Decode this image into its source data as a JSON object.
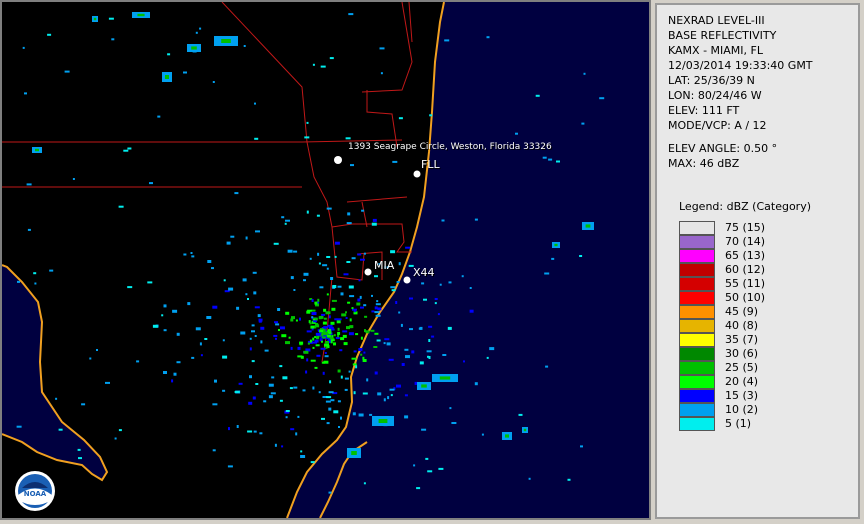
{
  "info": {
    "product_line1": "NEXRAD LEVEL-III",
    "product_line2": "BASE REFLECTIVITY",
    "station": "KAMX - MIAMI, FL",
    "datetime": "12/03/2014 19:33:40 GMT",
    "lat": "LAT: 25/36/39 N",
    "lon": "LON: 80/24/46 W",
    "elev": "ELEV: 111 FT",
    "mode": "MODE/VCP: A / 12",
    "elev_angle": "ELEV ANGLE: 0.50 °",
    "max": "MAX: 46 dBZ"
  },
  "legend": {
    "title": "Legend: dBZ (Category)",
    "entries": [
      {
        "label": "75  (15)",
        "color": "#e6e6e6"
      },
      {
        "label": "70  (14)",
        "color": "#9966cc"
      },
      {
        "label": "65  (13)",
        "color": "#ff00ff"
      },
      {
        "label": "60  (12)",
        "color": "#c00000"
      },
      {
        "label": "55  (11)",
        "color": "#d40000"
      },
      {
        "label": "50  (10)",
        "color": "#ff0000"
      },
      {
        "label": "45  (9)",
        "color": "#ff9000"
      },
      {
        "label": "40  (8)",
        "color": "#e6b400"
      },
      {
        "label": "35  (7)",
        "color": "#ffff00"
      },
      {
        "label": "30  (6)",
        "color": "#008800"
      },
      {
        "label": "25  (5)",
        "color": "#00c000"
      },
      {
        "label": "20  (4)",
        "color": "#00ff00"
      },
      {
        "label": "15  (3)",
        "color": "#0000ff"
      },
      {
        "label": "10  (2)",
        "color": "#00a0f0"
      },
      {
        "label": "5  (1)",
        "color": "#00eeee"
      }
    ]
  },
  "map": {
    "address_label": "1393 Seagrape Circle, Weston, Florida 33326",
    "city_labels": [
      "FLL",
      "MIA",
      "X44"
    ],
    "colors": {
      "water": "#000040",
      "land": "#000000",
      "coastline": "#f0a020",
      "county_lines": "#c01818"
    }
  },
  "logo": {
    "name": "noaa-logo",
    "text": "NOAA"
  }
}
